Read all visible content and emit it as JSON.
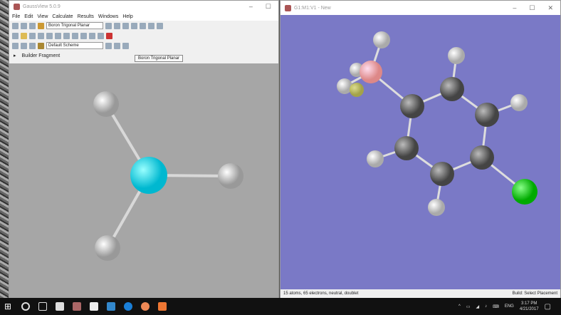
{
  "left_window": {
    "title": "GaussView 5.0.9",
    "menu": [
      "File",
      "Edit",
      "View",
      "Calculate",
      "Results",
      "Windows",
      "Help"
    ],
    "fragment_combo": "Boron Trigonal Planar",
    "scheme_combo": "Default Scheme",
    "builder_label": "Builder Fragment",
    "tooltip": "Boron Trigonal Planar"
  },
  "right_window": {
    "title": "G1:M1:V1 - New",
    "status_left": "15 atoms, 65 electrons, neutral, doublet",
    "status_right": "Build: Select Placement"
  },
  "taskbar": {
    "lang": "ENG",
    "time": "3:17 PM",
    "date": "4/21/2017"
  },
  "colors": {
    "viewport_left": "#a6a6a6",
    "viewport_right": "#7a79c6",
    "boron_left": "#00e0f0",
    "boron_right": "#f0a8b0",
    "chlorine": "#20d020",
    "carbon": "#707070",
    "hydrogen": "#e0e0e0"
  }
}
